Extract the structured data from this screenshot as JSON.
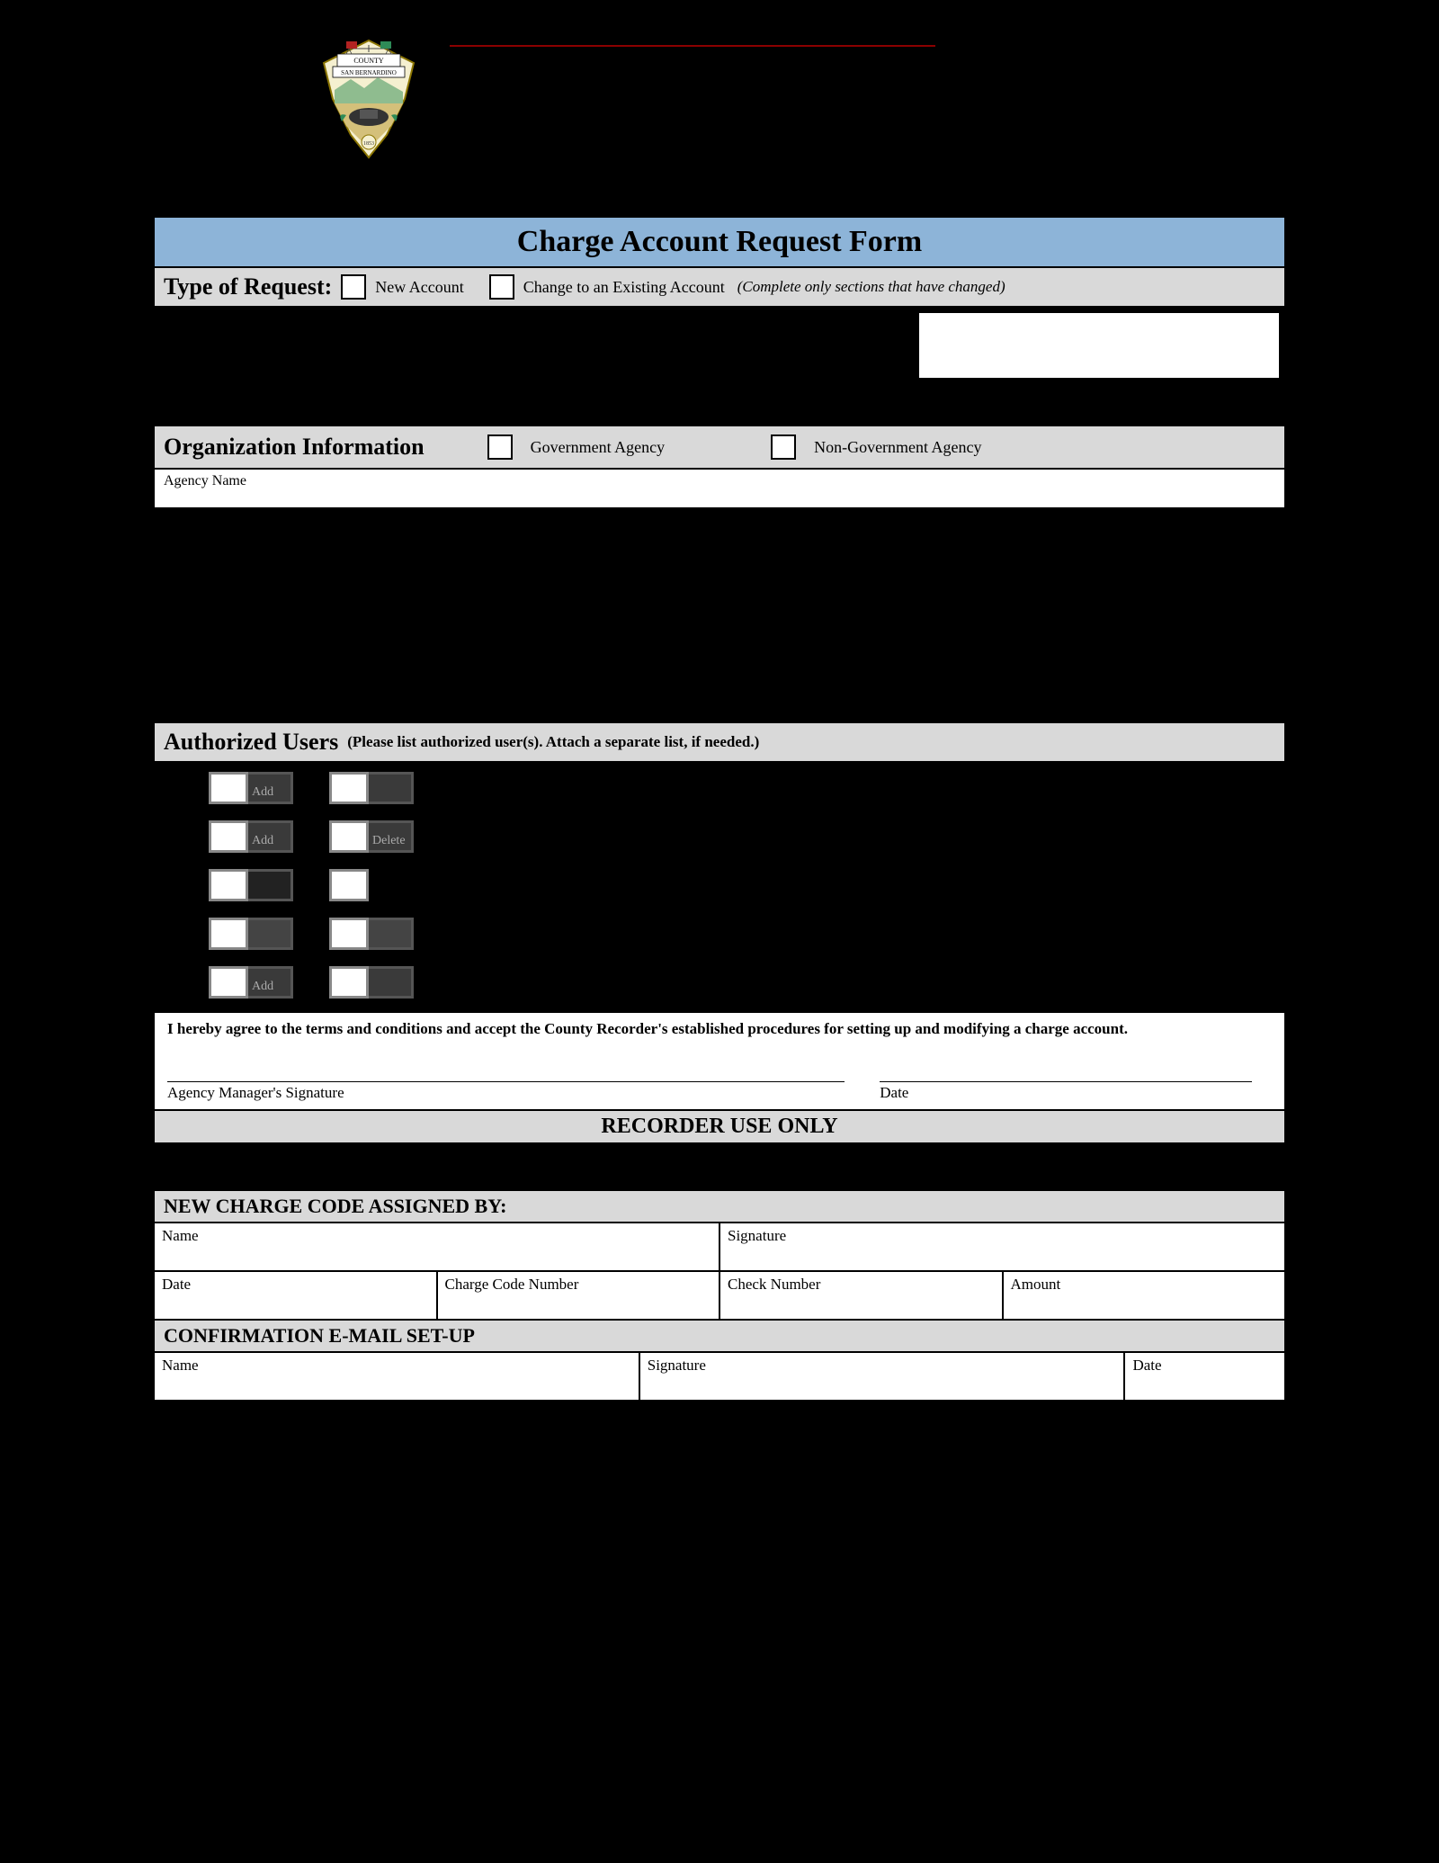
{
  "header": {
    "county": "COUNTY",
    "of": "SAN BERNARDINO"
  },
  "form_title": "Charge Account Request Form",
  "type_of_request": {
    "label": "Type of Request:",
    "new_account": "New Account",
    "change_existing": "Change to an Existing Account",
    "change_note": "(Complete only sections that have changed)"
  },
  "org_info": {
    "title": "Organization Information",
    "gov": "Government Agency",
    "nongov": "Non-Government Agency",
    "agency_name": "Agency Name"
  },
  "auth_users": {
    "title": "Authorized Users",
    "subtitle": "(Please list authorized user(s). Attach a separate list, if needed.)",
    "add": "Add",
    "delete": "Delete"
  },
  "agreement": {
    "text": "I hereby agree to the terms and conditions and accept the County Recorder's established procedures for setting up and modifying a charge account.",
    "sig": "Agency Manager's Signature",
    "date": "Date"
  },
  "recorder_only": "RECORDER USE ONLY",
  "new_code": {
    "title": "NEW CHARGE CODE ASSIGNED BY:",
    "name": "Name",
    "signature": "Signature",
    "date": "Date",
    "code": "Charge Code Number",
    "check": "Check Number",
    "amount": "Amount"
  },
  "confirm": {
    "title": "CONFIRMATION E-MAIL SET-UP",
    "name": "Name",
    "signature": "Signature",
    "date": "Date"
  }
}
